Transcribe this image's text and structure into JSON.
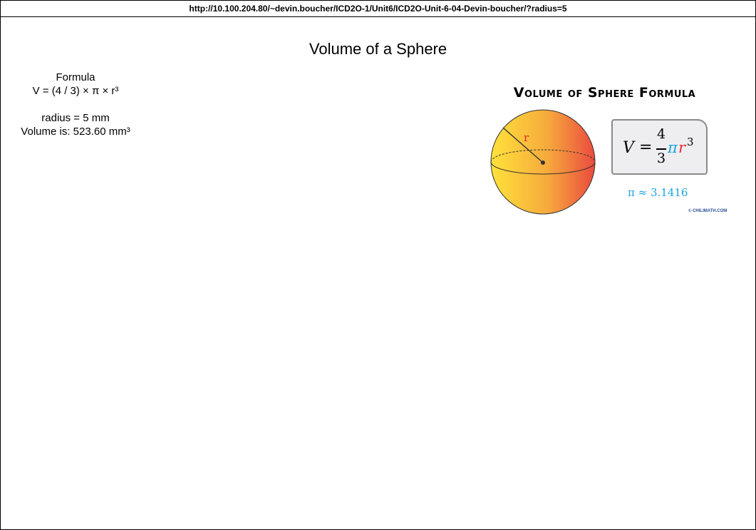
{
  "browser": {
    "url": "http://10.100.204.80/~devin.boucher/ICD2O-1/Unit6/ICD2O-Unit-6-04-Devin-boucher/?radius=5"
  },
  "page": {
    "title": "Volume of a Sphere",
    "formula_heading": "Formula",
    "formula_text": "V = (4 / 3) × π × r³",
    "radius_text": "radius = 5 mm",
    "volume_text": "Volume is: 523.60 mm³"
  },
  "formula_image": {
    "title": "Volume of Sphere Formula",
    "radius_label": "r",
    "eq_V": "V",
    "eq_equals": "=",
    "eq_numerator": "4",
    "eq_denominator": "3",
    "eq_pi": "π",
    "eq_r": "r",
    "eq_exponent": "3",
    "pi_approx": "π ≈ 3.1416",
    "credit": "© CHILIMATH.COM",
    "colors": {
      "sphere_light": "#ffe23a",
      "sphere_mid": "#f6a93d",
      "sphere_dark": "#ea4a3e",
      "pi_color": "#1aa3e0",
      "r_color": "#e8262a"
    }
  }
}
